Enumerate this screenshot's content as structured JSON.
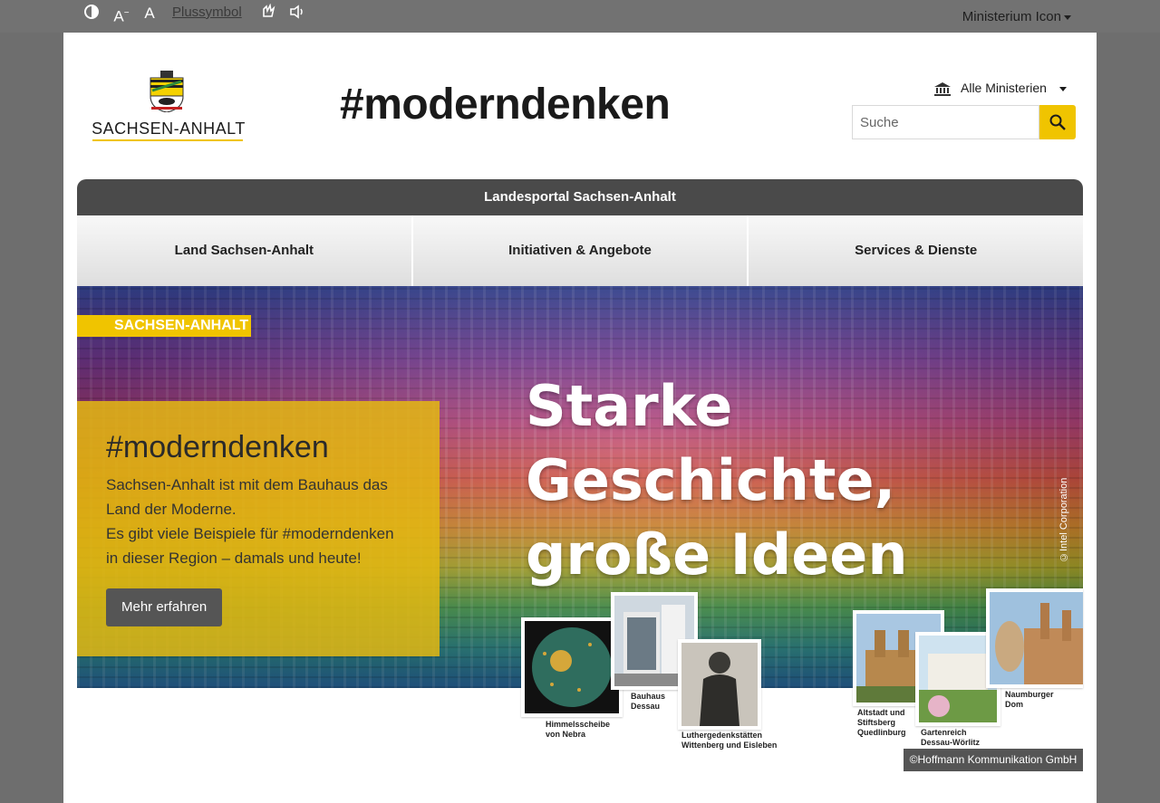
{
  "topbar": {
    "contrast_icon": "contrast-icon",
    "font_smaller_icon": "font-decrease-icon",
    "font_normal_icon": "font-size-icon",
    "plus_label": "Plussymbol",
    "sign_language_icon": "sign-language-icon",
    "speaker_icon": "speaker-icon",
    "ministry_label": "Ministerium Icon"
  },
  "header": {
    "logo_text": "SACHSEN-ANHALT",
    "headline": "#moderndenken",
    "ministry_select": "Alle Ministerien",
    "search_placeholder": "Suche"
  },
  "portal": {
    "title": "Landesportal Sachsen-Anhalt",
    "nav": [
      "Land Sachsen-Anhalt",
      "Initiativen & Angebote",
      "Services & Dienste"
    ]
  },
  "hero": {
    "badge": "SACHSEN-ANHALT",
    "box_title": "#moderndenken",
    "box_line1": "Sachsen-Anhalt ist mit dem Bauhaus das",
    "box_line2": "Land der Moderne.",
    "box_line3": "Es gibt viele Beispiele für #moderndenken",
    "box_line4": "in dieser Region – damals und heute!",
    "button": "Mehr erfahren",
    "slogan_line1": "Starke Geschichte,",
    "slogan_line2": "große Ideen",
    "photo_copyright": "©Intel Corporation",
    "collage_labels": {
      "nebra": "Himmelsscheibe\nvon Nebra",
      "bauhaus": "Bauhaus\nDessau",
      "luther": "Luthergedenkstätten\nWittenberg und Eisleben",
      "quedlinburg": "Altstadt und\nStiftsberg\nQuedlinburg",
      "woerlitz": "Gartenreich\nDessau-Wörlitz",
      "naumburg": "Naumburger\nDom"
    },
    "credit": "©Hoffmann Kommunikation GmbH"
  },
  "colors": {
    "accent_yellow": "#f0c400",
    "dark_bar": "#4a4a4a",
    "button_grey": "#555555"
  }
}
